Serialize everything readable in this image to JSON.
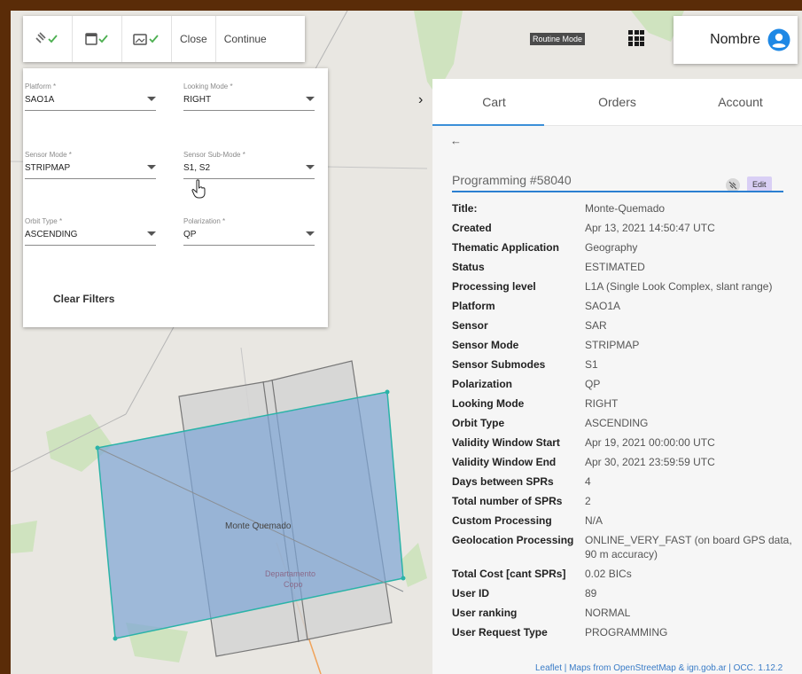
{
  "toolbar": {
    "icons": [
      "satellite-check-icon",
      "calendar-check-icon",
      "image-settings-check-icon"
    ],
    "close_label": "Close",
    "continue_label": "Continue"
  },
  "filters": {
    "platform": {
      "label": "Platform *",
      "value": "SAO1A"
    },
    "looking_mode": {
      "label": "Looking Mode *",
      "value": "RIGHT"
    },
    "sensor_mode": {
      "label": "Sensor Mode *",
      "value": "STRIPMAP"
    },
    "sensor_sub_mode": {
      "label": "Sensor Sub-Mode *",
      "value": "S1, S2"
    },
    "orbit_type": {
      "label": "Orbit Type *",
      "value": "ASCENDING"
    },
    "polarization": {
      "label": "Polarization *",
      "value": "QP"
    },
    "clear_label": "Clear Filters"
  },
  "header": {
    "routine_mode": "Routine Mode",
    "user_name": "Nombre"
  },
  "map": {
    "labels": [
      "Monte Quemado",
      "Departamento",
      "Copo"
    ],
    "attribution": "Leaflet | Maps from OpenStreetMap & ign.gob.ar | OCC. 1.12.2"
  },
  "detail": {
    "tabs": [
      "Cart",
      "Orders",
      "Account"
    ],
    "active_tab": "Cart",
    "back_arrow": "←",
    "collapse_arrow": "›",
    "programming_title": "Programming #58040",
    "edit_label": "Edit",
    "rows": [
      {
        "k": "Title:",
        "v": "Monte-Quemado"
      },
      {
        "k": "Created",
        "v": "Apr 13, 2021 14:50:47 UTC"
      },
      {
        "k": "Thematic Application",
        "v": "Geography"
      },
      {
        "k": "Status",
        "v": "ESTIMATED"
      },
      {
        "k": "Processing level",
        "v": "L1A (Single Look Complex, slant range)"
      },
      {
        "k": "Platform",
        "v": "SAO1A"
      },
      {
        "k": "Sensor",
        "v": "SAR"
      },
      {
        "k": "Sensor Mode",
        "v": "STRIPMAP"
      },
      {
        "k": "Sensor Submodes",
        "v": "S1"
      },
      {
        "k": "Polarization",
        "v": "QP"
      },
      {
        "k": "Looking Mode",
        "v": "RIGHT"
      },
      {
        "k": "Orbit Type",
        "v": "ASCENDING"
      },
      {
        "k": "Validity Window Start",
        "v": "Apr 19, 2021 00:00:00 UTC"
      },
      {
        "k": "Validity Window End",
        "v": "Apr 30, 2021 23:59:59 UTC"
      },
      {
        "k": "Days between SPRs",
        "v": "4"
      },
      {
        "k": "Total number of SPRs",
        "v": "2"
      },
      {
        "k": "Custom Processing",
        "v": "N/A"
      },
      {
        "k": "Geolocation Processing",
        "v": "ONLINE_VERY_FAST (on board GPS data, 90 m accuracy)"
      },
      {
        "k": "Total Cost [cant SPRs]",
        "v": "0.02 BICs"
      },
      {
        "k": "User ID",
        "v": "89"
      },
      {
        "k": "User ranking",
        "v": "NORMAL"
      },
      {
        "k": "User Request Type",
        "v": "PROGRAMMING"
      }
    ]
  },
  "colors": {
    "accent": "#3b8fd8",
    "aoi_fill": "#8fb0d8",
    "aoi_stroke": "#2bb3a8",
    "edit_bg": "#d9cff5",
    "user_icon": "#1e88e5"
  }
}
